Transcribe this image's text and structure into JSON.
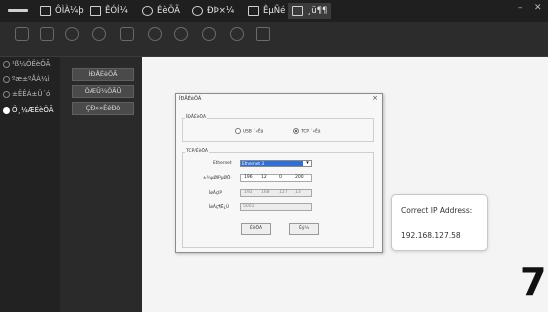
{
  "titlebar": {
    "menu": [
      {
        "label": "ÔÌÀ¼þ",
        "icon": "window-icon"
      },
      {
        "label": "ÊÓÍ¼",
        "icon": "monitor-icon"
      },
      {
        "label": "ÉèÖÃ",
        "icon": "gear-icon"
      },
      {
        "label": "ÐÞ×¼",
        "icon": "tool-icon"
      },
      {
        "label": "ÊµÑé",
        "icon": "folder-icon"
      },
      {
        "label": "¸ü¶¶",
        "icon": "list-icon"
      }
    ],
    "window_controls": {
      "minimize": "–",
      "close": "✕"
    }
  },
  "sidebar": {
    "items": [
      {
        "label": "¹ß¼ÓËèÖÃ"
      },
      {
        "label": "ºæ±ºÅÀ¼ì"
      },
      {
        "label": "±ÊÊÁ±Ü´ó"
      },
      {
        "label": "Ö¸¼ÆÉèÖÃ"
      }
    ]
  },
  "subpanel": {
    "buttons": [
      "ÍÐÅÉèÖÃ",
      "ÖÆÛ¼ÖÃÛ",
      "ÇÐ»»ÈéÐò"
    ]
  },
  "dialog": {
    "title": "ÍÐÅÉèÖÃ",
    "close_label": "×",
    "mode_group": {
      "label": "ÍÐÅÉèÖÃ",
      "options": [
        {
          "label": "USB ´«Êä",
          "selected": false
        },
        {
          "label": "TCP ´«Êä",
          "selected": true
        }
      ]
    },
    "tcp_group": {
      "label": "TCP/ÉèÖÃ",
      "ethernet_label": "Ethernet",
      "ethernet_value": "Ethernet 3",
      "ip_label": "±¾µØIPµØÖ·",
      "ip_octets": [
        "196",
        "12",
        "0",
        "200"
      ],
      "remote_ip_label": "ÍøÂçIP",
      "remote_ip_octets": [
        "192",
        "168",
        "127",
        "13"
      ],
      "port_label": "ÍøÂç¶Ë¿Ú",
      "port_value": "5001"
    },
    "ok_label": "ÉèÖÃ",
    "cancel_label": "Èý¼"
  },
  "callout": {
    "title": "Correct IP Address:",
    "ip": "192.168.127.58"
  },
  "step_number": "7",
  "colors": {
    "titlebar": "#1f1f1f",
    "toolbar": "#2c2c2c",
    "sidebar": "#222222",
    "selection": "#2e6fd8"
  }
}
